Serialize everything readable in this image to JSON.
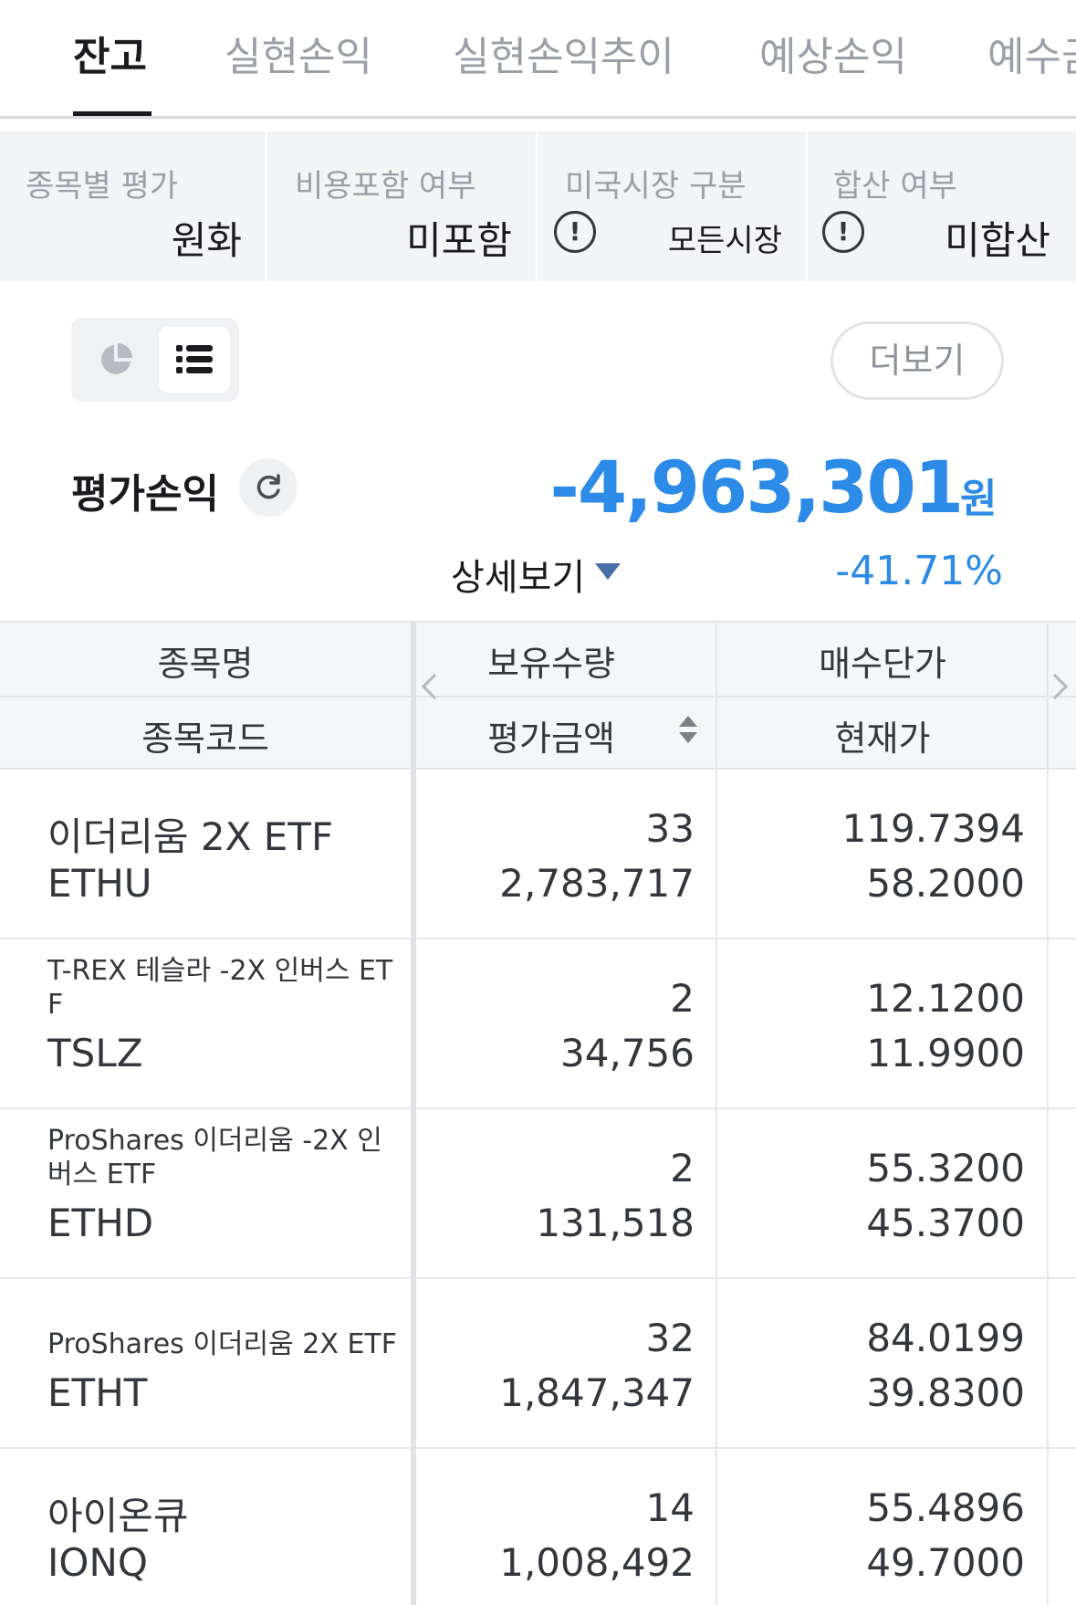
{
  "tabs": [
    "잔고",
    "실현손익",
    "실현손익추이",
    "예상손익",
    "예수금"
  ],
  "active_tab_index": 0,
  "filters": [
    {
      "label": "종목별 평가",
      "value": "원화"
    },
    {
      "label": "비용포함 여부",
      "value": "미포함"
    },
    {
      "label": "미국시장 구분",
      "value": "모든시장",
      "icon": "info-icon"
    },
    {
      "label": "합산 여부",
      "value": "미합산",
      "icon": "info-icon"
    }
  ],
  "view_toggle": {
    "options": [
      "pie-chart-icon",
      "list-icon"
    ],
    "selected": "list-icon"
  },
  "more_label": "더보기",
  "summary": {
    "title": "평가손익",
    "amount": "-4,963,301",
    "unit": "원",
    "detail_label": "상세보기",
    "rate": "-41.71%",
    "accent_color": "#2b8be6"
  },
  "table": {
    "headers": {
      "col1_top": "종목명",
      "col1_bottom": "종목코드",
      "col2_top": "보유수량",
      "col2_bottom": "평가금액",
      "col3_top": "매수단가",
      "col3_bottom": "현재가"
    },
    "rows": [
      {
        "name_lines": [
          "이더리움 2X ETF"
        ],
        "code": "ETHU",
        "qty": "33",
        "eval": "2,783,717",
        "buy_price": "119.7394",
        "cur_price": "58.2000"
      },
      {
        "name_lines": [
          "T-REX 테슬라 -2X 인버스 ET",
          "F"
        ],
        "code": "TSLZ",
        "qty": "2",
        "eval": "34,756",
        "buy_price": "12.1200",
        "cur_price": "11.9900"
      },
      {
        "name_lines": [
          "ProShares 이더리움 -2X 인",
          "버스 ETF"
        ],
        "code": "ETHD",
        "qty": "2",
        "eval": "131,518",
        "buy_price": "55.3200",
        "cur_price": "45.3700"
      },
      {
        "name_lines": [
          "ProShares 이더리움 2X ETF"
        ],
        "code": "ETHT",
        "qty": "32",
        "eval": "1,847,347",
        "buy_price": "84.0199",
        "cur_price": "39.8300"
      },
      {
        "name_lines": [
          "아이온큐"
        ],
        "code": "IONQ",
        "qty": "14",
        "eval": "1,008,492",
        "buy_price": "55.4896",
        "cur_price": "49.7000"
      }
    ]
  }
}
